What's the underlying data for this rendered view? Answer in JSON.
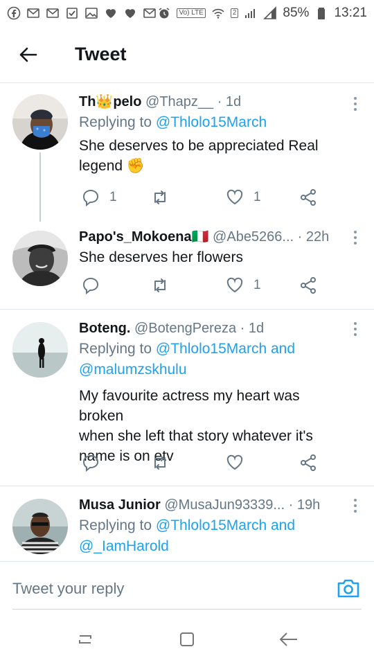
{
  "status_bar": {
    "battery_percent": "85%",
    "time": "13:21",
    "sim_badge": "2",
    "volte": "Vo) LTE"
  },
  "header": {
    "title": "Tweet"
  },
  "tweets": [
    {
      "name": "Th👑pelo",
      "handle": "@Thapz__",
      "time": "· 1d",
      "replying_prefix": "Replying to ",
      "replying_to": "@Thlolo15March",
      "text_line1": "She deserves to be appreciated Real",
      "text_line2": "legend ✊",
      "reply_count": "1",
      "retweet_count": "",
      "like_count": "1"
    },
    {
      "name": "Papo's_Mokoena🇮🇹",
      "handle": "@Abe5266...",
      "time": "· 22h",
      "text": "She deserves her flowers",
      "reply_count": "",
      "retweet_count": "",
      "like_count": "1"
    },
    {
      "name": "Boteng.",
      "handle": "@BotengPereza",
      "time": "· 1d",
      "replying_prefix": "Replying to ",
      "replying_to": "@Thlolo15March and",
      "replying_to_2": "@malumzskhulu",
      "text_line1": "My favourite actress my heart was broken",
      "text_line2": "when she left that story whatever it's",
      "text_line3": "name is on etv",
      "reply_count": "",
      "retweet_count": "",
      "like_count": ""
    },
    {
      "name": "Musa Junior",
      "handle": "@MusaJun93339...",
      "time": "· 19h",
      "replying_prefix": "Replying to ",
      "replying_to": "@Thlolo15March and",
      "replying_to_2": "@_IamHarold"
    }
  ],
  "reply_box": {
    "placeholder": "Tweet your reply"
  },
  "colors": {
    "accent": "#1da1f2",
    "secondary_text": "#657786",
    "divider": "#e1e8ed"
  }
}
